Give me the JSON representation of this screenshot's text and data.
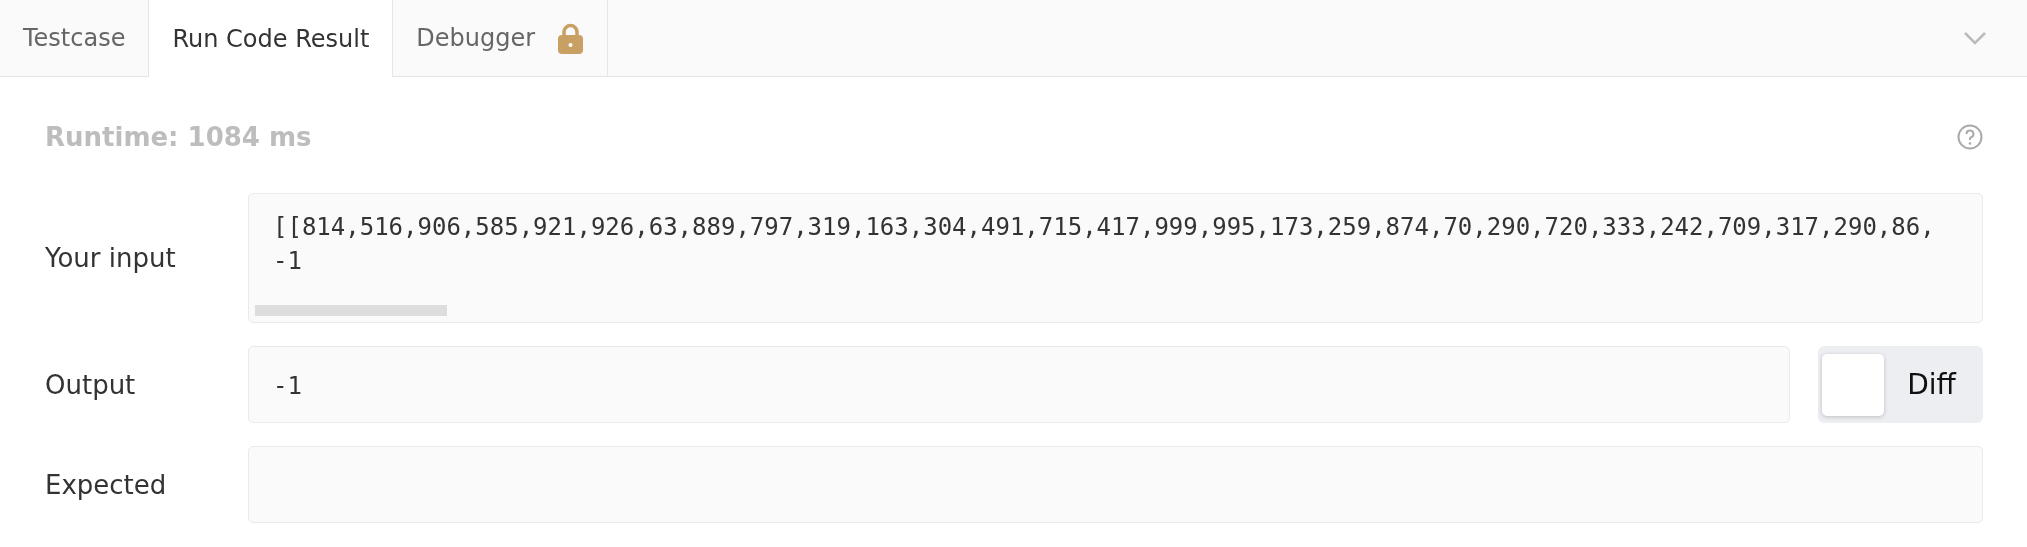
{
  "tabs": [
    {
      "label": "Testcase",
      "selected": false,
      "locked": false
    },
    {
      "label": "Run Code Result",
      "selected": true,
      "locked": false
    },
    {
      "label": "Debugger",
      "selected": false,
      "locked": true
    }
  ],
  "runtime": "Runtime: 1084 ms",
  "rows": [
    {
      "label": "Your input",
      "kind": "input",
      "lines": [
        "[[814,516,906,585,921,926,63,889,797,319,163,304,491,715,417,999,995,173,259,874,70,290,720,333,242,709,317,290,86,",
        "-1"
      ]
    },
    {
      "label": "Output",
      "kind": "output",
      "lines": [
        "-1"
      ],
      "diff": {
        "label": "Diff",
        "on": false
      }
    },
    {
      "label": "Expected",
      "kind": "output"
    }
  ]
}
